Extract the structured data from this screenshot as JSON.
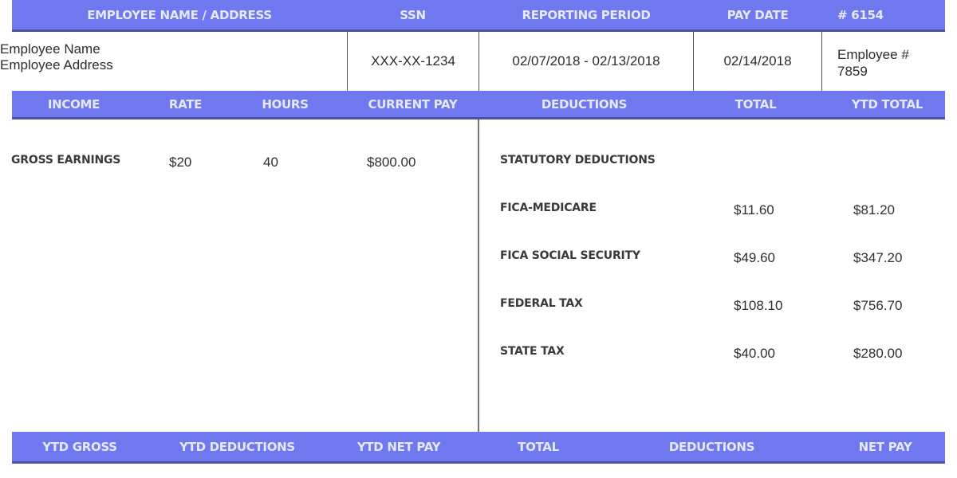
{
  "theme": {
    "band_color": "#6f78ee",
    "band_border": "#4d539c",
    "band_text": "#e6e8ff"
  },
  "top_header": {
    "employee_name_address": "EMPLOYEE NAME / ADDRESS",
    "ssn": "SSN",
    "reporting_period": "REPORTING PERIOD",
    "pay_date": "PAY DATE",
    "check_number": "# 6154"
  },
  "info": {
    "employee_name": "Employee Name",
    "employee_address": "Employee Address",
    "ssn": "XXX-XX-1234",
    "reporting_period": "02/07/2018 - 02/13/2018",
    "pay_date": "02/14/2018",
    "employee_number_label": "Employee #",
    "employee_number": "7859"
  },
  "mid_header": {
    "income": "INCOME",
    "rate": "RATE",
    "hours": "HOURS",
    "current_pay": "CURRENT PAY",
    "deductions": "DEDUCTIONS",
    "total": "TOTAL",
    "ytd_total": "YTD TOTAL"
  },
  "income": [
    {
      "label": "GROSS EARNINGS",
      "rate": "$20",
      "hours": "40",
      "current_pay": "$800.00"
    }
  ],
  "deductions": {
    "section_label": "STATUTORY DEDUCTIONS",
    "items": [
      {
        "label": "FICA-MEDICARE",
        "total": "$11.60",
        "ytd_total": "$81.20"
      },
      {
        "label": "FICA SOCIAL SECURITY",
        "total": "$49.60",
        "ytd_total": "$347.20"
      },
      {
        "label": "FEDERAL TAX",
        "total": "$108.10",
        "ytd_total": "$756.70"
      },
      {
        "label": "STATE TAX",
        "total": "$40.00",
        "ytd_total": "$280.00"
      }
    ]
  },
  "bottom_header": {
    "ytd_gross": "YTD GROSS",
    "ytd_deductions": "YTD DEDUCTIONS",
    "ytd_net_pay": "YTD NET PAY",
    "total": "TOTAL",
    "deductions": "DEDUCTIONS",
    "net_pay": "NET PAY"
  }
}
